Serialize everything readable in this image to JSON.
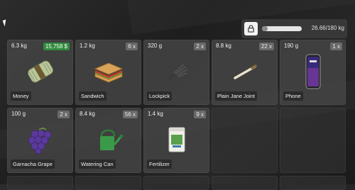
{
  "weight": {
    "text": "26.66/180 kg",
    "fill_fraction": 0.148
  },
  "items": [
    {
      "name": "Money",
      "weight": "6.3 kg",
      "price": "15,758 $",
      "icon": "money-icon"
    },
    {
      "name": "Sandwich",
      "weight": "1.2 kg",
      "qty": "6 x",
      "icon": "sandwich-icon"
    },
    {
      "name": "Lockpick",
      "weight": "320 g",
      "qty": "2 x",
      "icon": "lockpick-icon"
    },
    {
      "name": "Plain Jane Joint",
      "weight": "8.8 kg",
      "qty": "22 x",
      "icon": "joint-icon"
    },
    {
      "name": "Phone",
      "weight": "190 g",
      "qty": "1 x",
      "icon": "phone-icon"
    },
    {
      "name": "Garnacha Grape",
      "weight": "100 g",
      "qty": "2 x",
      "icon": "grape-icon"
    },
    {
      "name": "Watering Can",
      "weight": "8.4 kg",
      "qty": "56 x",
      "icon": "watering-can-icon"
    },
    {
      "name": "Fertilizer",
      "weight": "1.4 kg",
      "qty": "9 x",
      "icon": "fertilizer-icon"
    }
  ],
  "colors": {
    "price_badge": "#2f8a3c",
    "slot_bg": "#464646",
    "accent_light": "#f2f2f2"
  }
}
